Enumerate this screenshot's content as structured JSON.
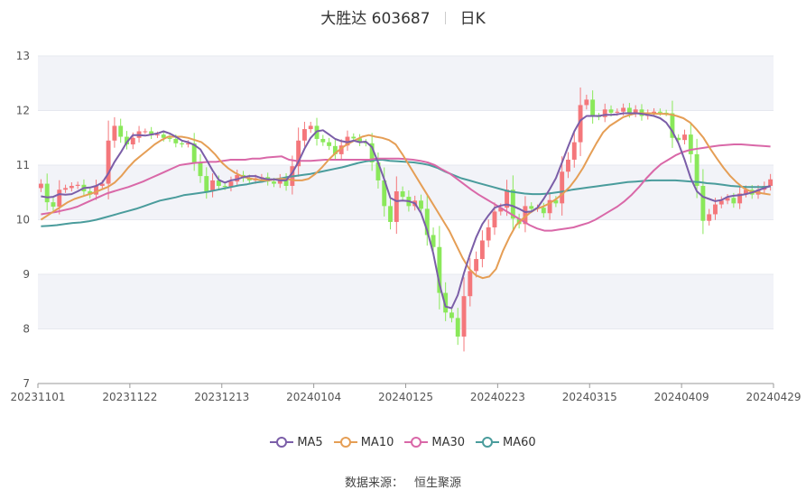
{
  "header": {
    "name_code": "大胜达 603687",
    "period": "日K"
  },
  "footer": {
    "source_label": "数据来源：",
    "source_value": "恒生聚源"
  },
  "colors": {
    "up": "#f4777b",
    "down": "#8ae85a",
    "MA5": "#7b5ea8",
    "MA10": "#e59e55",
    "MA30": "#d968a8",
    "MA60": "#4a9c9c",
    "band": "#f2f3f8",
    "grid": "#e6e8ef"
  },
  "chart_data": {
    "type": "candlestick",
    "ylim": [
      7,
      13
    ],
    "yticks": [
      7,
      8,
      9,
      10,
      11,
      12,
      13
    ],
    "xticks": [
      "20231101",
      "20231122",
      "20231213",
      "20240104",
      "20240125",
      "20240223",
      "20240315",
      "20240409",
      "20240429"
    ],
    "legend": [
      "MA5",
      "MA10",
      "MA30",
      "MA60"
    ],
    "legend_position": "bottom",
    "num_days": 120,
    "close": [
      10.66,
      10.32,
      10.24,
      10.55,
      10.58,
      10.62,
      10.64,
      10.52,
      10.46,
      10.62,
      10.66,
      11.45,
      11.72,
      11.52,
      11.38,
      11.5,
      11.62,
      11.62,
      11.55,
      11.56,
      11.5,
      11.48,
      11.4,
      11.38,
      11.4,
      11.05,
      10.8,
      10.52,
      10.72,
      10.62,
      10.6,
      10.7,
      10.82,
      10.76,
      10.72,
      10.76,
      10.78,
      10.7,
      10.66,
      10.75,
      10.62,
      10.98,
      11.45,
      11.66,
      11.72,
      11.48,
      11.42,
      11.35,
      11.2,
      11.36,
      11.52,
      11.49,
      11.42,
      11.4,
      11.05,
      10.72,
      10.25,
      9.96,
      10.52,
      10.42,
      10.25,
      10.35,
      10.2,
      9.72,
      9.5,
      8.66,
      8.3,
      8.2,
      7.86,
      8.6,
      9.06,
      9.28,
      9.62,
      9.86,
      10.15,
      10.22,
      10.55,
      10.02,
      9.92,
      10.25,
      10.2,
      10.22,
      10.12,
      10.36,
      10.3,
      10.88,
      11.1,
      11.42,
      12.1,
      12.2,
      11.9,
      11.88,
      12.02,
      11.96,
      11.98,
      12.05,
      11.95,
      12.02,
      11.9,
      11.95,
      11.98,
      11.96,
      11.95,
      11.5,
      11.46,
      11.56,
      11.2,
      10.62,
      9.98,
      10.1,
      10.28,
      10.35,
      10.4,
      10.3,
      10.48,
      10.55,
      10.46,
      10.55,
      10.62,
      10.74
    ],
    "ma5": [
      10.43,
      10.41,
      10.42,
      10.47,
      10.46,
      10.47,
      10.52,
      10.58,
      10.59,
      10.62,
      10.68,
      10.85,
      11.06,
      11.23,
      11.42,
      11.55,
      11.55,
      11.54,
      11.56,
      11.58,
      11.62,
      11.58,
      11.52,
      11.45,
      11.42,
      11.37,
      11.29,
      11.1,
      10.9,
      10.73,
      10.68,
      10.72,
      10.74,
      10.78,
      10.8,
      10.8,
      10.76,
      10.74,
      10.74,
      10.72,
      10.72,
      10.86,
      11.06,
      11.3,
      11.5,
      11.62,
      11.64,
      11.56,
      11.48,
      11.44,
      11.42,
      11.45,
      11.42,
      11.43,
      11.33,
      11.05,
      10.74,
      10.4,
      10.34,
      10.35,
      10.34,
      10.3,
      10.12,
      9.8,
      9.38,
      8.82,
      8.41,
      8.38,
      8.62,
      9.02,
      9.37,
      9.68,
      9.92,
      10.08,
      10.22,
      10.26,
      10.28,
      10.25,
      10.2,
      10.14,
      10.15,
      10.22,
      10.38,
      10.56,
      10.76,
      11.05,
      11.34,
      11.62,
      11.82,
      11.9,
      11.9,
      11.9,
      11.92,
      11.92,
      11.93,
      11.95,
      11.95,
      11.95,
      11.94,
      11.92,
      11.9,
      11.86,
      11.78,
      11.62,
      11.4,
      11.1,
      10.76,
      10.52,
      10.42,
      10.38,
      10.34,
      10.36,
      10.42,
      10.44,
      10.45,
      10.47,
      10.5,
      10.54,
      10.58,
      10.62
    ],
    "ma10": [
      10.0,
      10.08,
      10.16,
      10.24,
      10.32,
      10.38,
      10.42,
      10.46,
      10.5,
      10.55,
      10.6,
      10.68,
      10.8,
      10.95,
      11.08,
      11.18,
      11.28,
      11.38,
      11.46,
      11.52,
      11.52,
      11.52,
      11.5,
      11.46,
      11.42,
      11.32,
      11.2,
      11.05,
      10.94,
      10.86,
      10.8,
      10.76,
      10.74,
      10.72,
      10.72,
      10.74,
      10.75,
      10.74,
      10.72,
      10.72,
      10.75,
      10.84,
      10.96,
      11.1,
      11.22,
      11.32,
      11.4,
      11.46,
      11.52,
      11.55,
      11.52,
      11.5,
      11.46,
      11.38,
      11.2,
      11.0,
      10.8,
      10.6,
      10.4,
      10.2,
      10.0,
      9.8,
      9.55,
      9.3,
      9.1,
      8.98,
      8.93,
      8.96,
      9.1,
      9.42,
      9.68,
      9.9,
      10.02,
      10.12,
      10.2,
      10.24,
      10.3,
      10.38,
      10.48,
      10.6,
      10.76,
      10.95,
      11.18,
      11.4,
      11.6,
      11.72,
      11.8,
      11.88,
      11.92,
      11.95,
      11.95,
      11.95,
      11.94,
      11.94,
      11.93,
      11.9,
      11.86,
      11.78,
      11.65,
      11.5,
      11.3,
      11.12,
      10.95,
      10.8,
      10.68,
      10.58,
      10.52,
      10.5,
      10.48,
      10.46
    ],
    "ma30": [
      10.1,
      10.12,
      10.14,
      10.17,
      10.2,
      10.24,
      10.3,
      10.36,
      10.42,
      10.48,
      10.52,
      10.56,
      10.6,
      10.65,
      10.7,
      10.76,
      10.82,
      10.88,
      10.94,
      11.0,
      11.02,
      11.04,
      11.05,
      11.06,
      11.06,
      11.08,
      11.1,
      11.1,
      11.1,
      11.12,
      11.12,
      11.14,
      11.15,
      11.16,
      11.1,
      11.08,
      11.08,
      11.08,
      11.09,
      11.1,
      11.1,
      11.1,
      11.1,
      11.1,
      11.1,
      11.1,
      11.12,
      11.12,
      11.12,
      11.12,
      11.11,
      11.1,
      11.08,
      11.05,
      11.0,
      10.92,
      10.85,
      10.75,
      10.65,
      10.55,
      10.46,
      10.38,
      10.3,
      10.22,
      10.14,
      10.06,
      9.98,
      9.9,
      9.84,
      9.8,
      9.8,
      9.82,
      9.84,
      9.86,
      9.9,
      9.94,
      10.0,
      10.08,
      10.16,
      10.24,
      10.34,
      10.46,
      10.6,
      10.76,
      10.9,
      11.02,
      11.1,
      11.18,
      11.24,
      11.28,
      11.3,
      11.32,
      11.34,
      11.36,
      11.37,
      11.38,
      11.38,
      11.37,
      11.36,
      11.35,
      11.34
    ],
    "ma60": [
      9.88,
      9.89,
      9.9,
      9.92,
      9.94,
      9.95,
      9.97,
      10.0,
      10.04,
      10.08,
      10.12,
      10.16,
      10.2,
      10.25,
      10.3,
      10.35,
      10.38,
      10.41,
      10.45,
      10.47,
      10.49,
      10.51,
      10.54,
      10.57,
      10.6,
      10.63,
      10.65,
      10.68,
      10.7,
      10.73,
      10.75,
      10.78,
      10.8,
      10.82,
      10.84,
      10.87,
      10.9,
      10.93,
      10.96,
      11.0,
      11.04,
      11.07,
      11.09,
      11.1,
      11.08,
      11.07,
      11.06,
      11.05,
      11.03,
      11.0,
      10.95,
      10.88,
      10.82,
      10.76,
      10.72,
      10.68,
      10.64,
      10.6,
      10.56,
      10.52,
      10.5,
      10.48,
      10.47,
      10.47,
      10.48,
      10.5,
      10.52,
      10.55,
      10.57,
      10.59,
      10.61,
      10.63,
      10.65,
      10.67,
      10.69,
      10.7,
      10.71,
      10.72,
      10.72,
      10.72,
      10.72,
      10.71,
      10.7,
      10.69,
      10.67,
      10.66,
      10.64,
      10.62,
      10.61,
      10.6,
      10.6,
      10.6,
      10.61
    ]
  }
}
